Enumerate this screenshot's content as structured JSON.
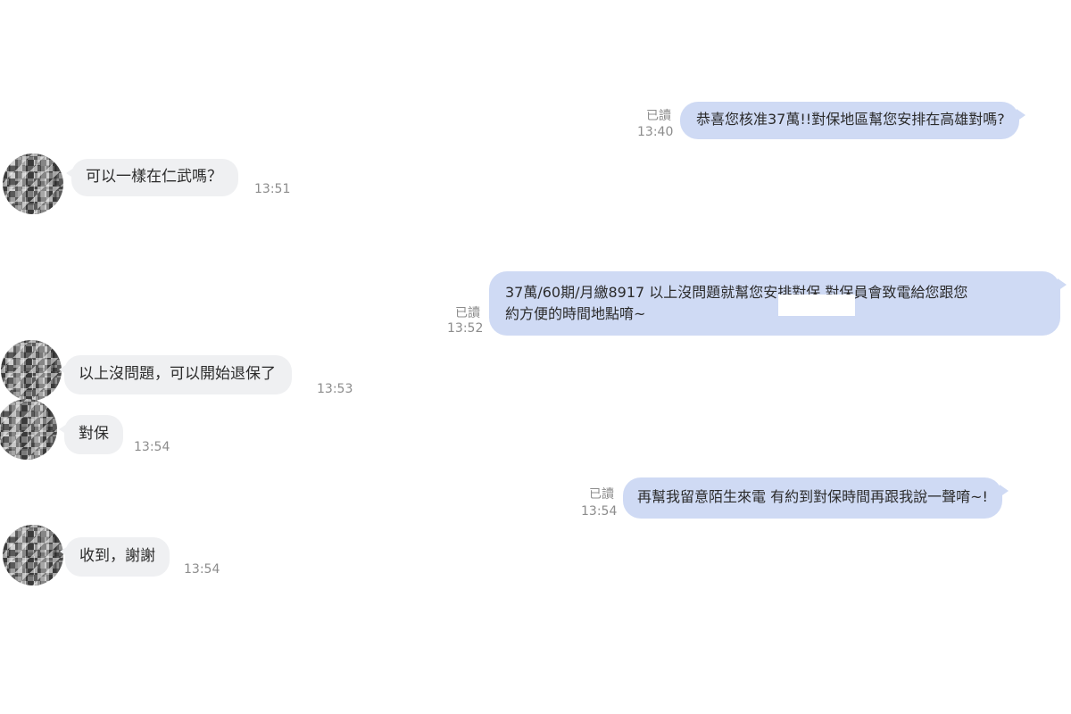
{
  "messages": [
    {
      "direction": "out",
      "text": "恭喜您核准37萬!!對保地區幫您安排在高雄對嗎?",
      "read": "已讀",
      "time": "13:40"
    },
    {
      "direction": "in",
      "text": "可以一樣在仁武嗎？",
      "time": "13:51"
    },
    {
      "direction": "out",
      "line1": "37萬/60期/月繳8917 以上沒問題就幫您安排對保 對保員會致電給您跟您",
      "line2": "約方便的時間地點唷~",
      "read": "已讀",
      "time": "13:52"
    },
    {
      "direction": "in",
      "text": "以上沒問題，可以開始退保了",
      "time": "13:53"
    },
    {
      "direction": "in",
      "text": "對保",
      "time": "13:54"
    },
    {
      "direction": "out",
      "text": "再幫我留意陌生來電 有約到對保時間再跟我說一聲唷~!",
      "read": "已讀",
      "time": "13:54"
    },
    {
      "direction": "in",
      "text": "收到，謝謝",
      "time": "13:54"
    }
  ]
}
